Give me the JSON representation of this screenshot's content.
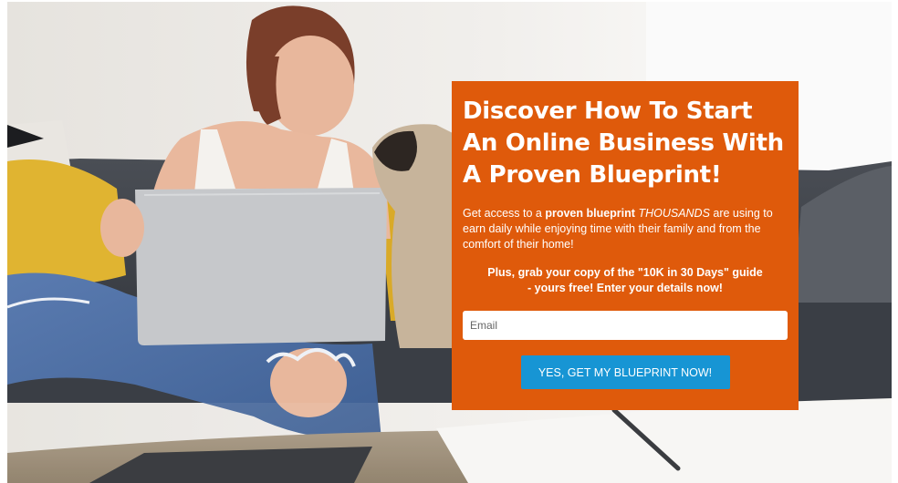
{
  "hero": {
    "image": "woman-with-laptop-and-pug-on-sofa",
    "colors": {
      "backdrop": "#ebe9e5",
      "sofa": "#3d4148",
      "pillow": "#e0b431",
      "laptop": "#c6c8cb"
    }
  },
  "optin": {
    "headline": "Discover How To Start An Online Business With A Proven Blueprint!",
    "lead_1": "Get access to a ",
    "lead_bold": "proven blueprint",
    "lead_space": " ",
    "lead_italic": "THOUSANDS",
    "lead_2": " are using to earn daily while enjoying time with their family and from the comfort of their home!",
    "offer_line1": "Plus, grab your copy of the \"10K in 30 Days\" guide",
    "offer_line2": "- yours free! Enter your details now!",
    "email_placeholder": "Email",
    "email_value": "",
    "cta_label": "YES, GET MY BLUEPRINT NOW!",
    "colors": {
      "panel": "#df5a0b",
      "button": "#1795d4",
      "text": "#ffffff"
    }
  }
}
